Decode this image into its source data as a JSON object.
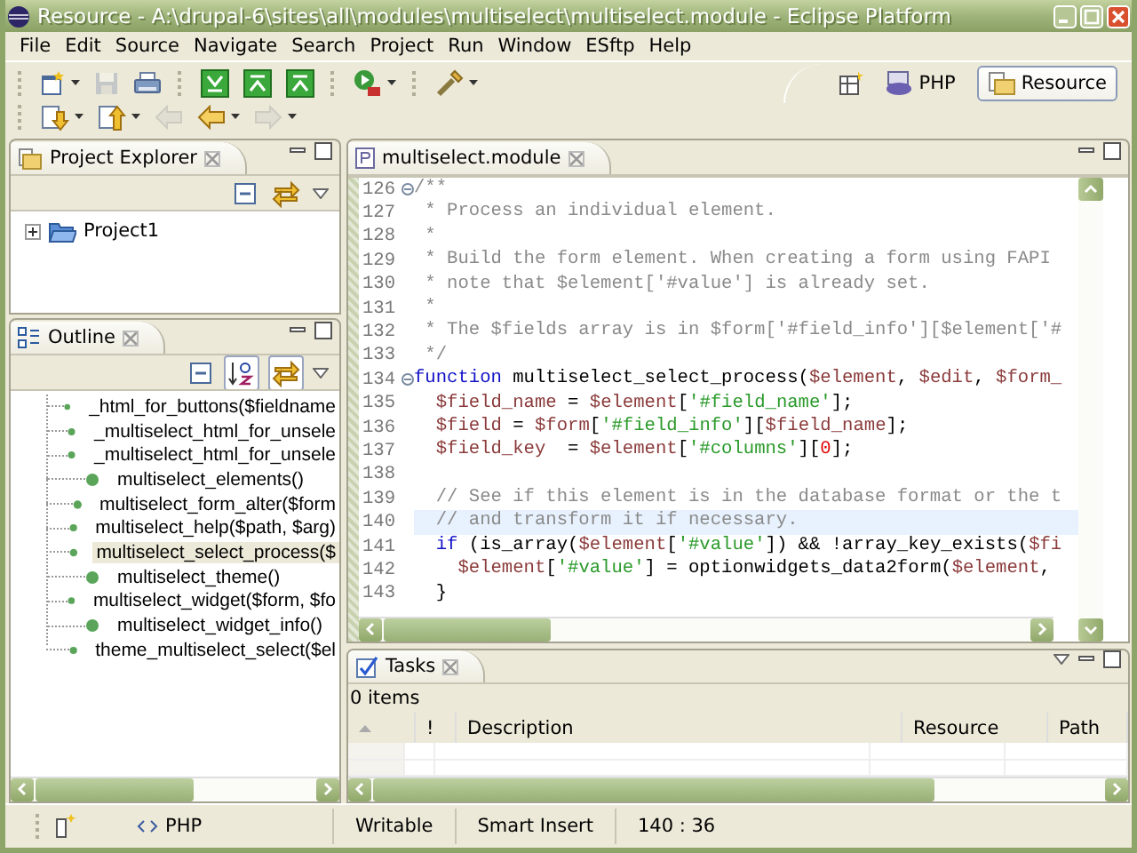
{
  "window": {
    "title": "Resource - A:\\drupal-6\\sites\\all\\modules\\multiselect\\multiselect.module - Eclipse Platform"
  },
  "menu": [
    "File",
    "Edit",
    "Source",
    "Navigate",
    "Search",
    "Project",
    "Run",
    "Window",
    "ESftp",
    "Help"
  ],
  "toolbar": {
    "rows": [
      [
        {
          "kind": "new-wizard",
          "disabled": false,
          "dropdown": true
        },
        {
          "kind": "save",
          "disabled": true,
          "dropdown": false
        },
        {
          "kind": "print",
          "disabled": false,
          "dropdown": false
        },
        {
          "kind": "separator"
        },
        {
          "kind": "green-down",
          "disabled": false,
          "dropdown": false
        },
        {
          "kind": "green-up",
          "disabled": false,
          "dropdown": false
        },
        {
          "kind": "green-up",
          "disabled": false,
          "dropdown": false
        },
        {
          "kind": "separator"
        },
        {
          "kind": "run",
          "disabled": false,
          "dropdown": true
        },
        {
          "kind": "separator"
        },
        {
          "kind": "tool",
          "disabled": false,
          "dropdown": true
        }
      ],
      [
        {
          "kind": "annotation-next",
          "disabled": false,
          "dropdown": true
        },
        {
          "kind": "annotation-prev",
          "disabled": false,
          "dropdown": true
        },
        {
          "kind": "back",
          "disabled": true,
          "dropdown": false
        },
        {
          "kind": "back",
          "disabled": false,
          "dropdown": true
        },
        {
          "kind": "forward",
          "disabled": true,
          "dropdown": true
        }
      ]
    ]
  },
  "perspectives": [
    {
      "label": "PHP",
      "selected": false
    },
    {
      "label": "Resource",
      "selected": true
    }
  ],
  "project_explorer": {
    "title": "Project Explorer",
    "tools": [
      {
        "kind": "collapse",
        "pressed": false
      },
      {
        "kind": "link",
        "pressed": false
      }
    ],
    "tree": [
      {
        "label": "Project1",
        "expanded": false
      }
    ]
  },
  "outline": {
    "title": "Outline",
    "tools": [
      {
        "kind": "collapse",
        "pressed": false
      },
      {
        "kind": "sort",
        "pressed": true
      },
      {
        "kind": "link",
        "pressed": true
      }
    ],
    "items": [
      {
        "label": "_html_for_buttons($fieldname",
        "selected": false
      },
      {
        "label": "_multiselect_html_for_unsele",
        "selected": false
      },
      {
        "label": "_multiselect_html_for_unsele",
        "selected": false
      },
      {
        "label": "multiselect_elements()",
        "selected": false
      },
      {
        "label": "multiselect_form_alter($form",
        "selected": false
      },
      {
        "label": "multiselect_help($path, $arg)",
        "selected": false
      },
      {
        "label": "multiselect_select_process($",
        "selected": true
      },
      {
        "label": "multiselect_theme()",
        "selected": false
      },
      {
        "label": "multiselect_widget($form, $fo",
        "selected": false
      },
      {
        "label": "multiselect_widget_info()",
        "selected": false
      },
      {
        "label": "theme_multiselect_select($el",
        "selected": false
      }
    ]
  },
  "editor": {
    "tab": "multiselect.module",
    "lines": [
      {
        "number": "126",
        "fold": true,
        "current": false,
        "tokens": [
          {
            "kind": "comment",
            "text": "/**"
          }
        ]
      },
      {
        "number": "127",
        "fold": false,
        "current": false,
        "tokens": [
          {
            "kind": "comment",
            "text": " * Process an individual element."
          }
        ]
      },
      {
        "number": "128",
        "fold": false,
        "current": false,
        "tokens": [
          {
            "kind": "comment",
            "text": " *"
          }
        ]
      },
      {
        "number": "129",
        "fold": false,
        "current": false,
        "tokens": [
          {
            "kind": "comment",
            "text": " * Build the form element. When creating a form using FAPI"
          }
        ]
      },
      {
        "number": "130",
        "fold": false,
        "current": false,
        "tokens": [
          {
            "kind": "comment",
            "text": " * note that $element['#value'] is already set."
          }
        ]
      },
      {
        "number": "131",
        "fold": false,
        "current": false,
        "tokens": [
          {
            "kind": "comment",
            "text": " *"
          }
        ]
      },
      {
        "number": "132",
        "fold": false,
        "current": false,
        "tokens": [
          {
            "kind": "comment",
            "text": " * The $fields array is in $form['#field_info'][$element['#"
          }
        ]
      },
      {
        "number": "133",
        "fold": false,
        "current": false,
        "tokens": [
          {
            "kind": "comment",
            "text": " */"
          }
        ]
      },
      {
        "number": "134",
        "fold": true,
        "current": false,
        "tokens": [
          {
            "kind": "keyword",
            "text": "function"
          },
          {
            "kind": "plain",
            "text": " multiselect_select_process("
          },
          {
            "kind": "variable",
            "text": "$element"
          },
          {
            "kind": "plain",
            "text": ", "
          },
          {
            "kind": "variable",
            "text": "$edit"
          },
          {
            "kind": "plain",
            "text": ", "
          },
          {
            "kind": "variable",
            "text": "$form_"
          }
        ]
      },
      {
        "number": "135",
        "fold": false,
        "current": false,
        "tokens": [
          {
            "kind": "variable",
            "text": "  $field_name"
          },
          {
            "kind": "plain",
            "text": " = "
          },
          {
            "kind": "variable",
            "text": "$element"
          },
          {
            "kind": "plain",
            "text": "["
          },
          {
            "kind": "string",
            "text": "'#field_name'"
          },
          {
            "kind": "plain",
            "text": "];"
          }
        ]
      },
      {
        "number": "136",
        "fold": false,
        "current": false,
        "tokens": [
          {
            "kind": "variable",
            "text": "  $field"
          },
          {
            "kind": "plain",
            "text": " = "
          },
          {
            "kind": "variable",
            "text": "$form"
          },
          {
            "kind": "plain",
            "text": "["
          },
          {
            "kind": "string",
            "text": "'#field_info'"
          },
          {
            "kind": "plain",
            "text": "]["
          },
          {
            "kind": "variable",
            "text": "$field_name"
          },
          {
            "kind": "plain",
            "text": "];"
          }
        ]
      },
      {
        "number": "137",
        "fold": false,
        "current": false,
        "tokens": [
          {
            "kind": "variable",
            "text": "  $field_key"
          },
          {
            "kind": "plain",
            "text": "  = "
          },
          {
            "kind": "variable",
            "text": "$element"
          },
          {
            "kind": "plain",
            "text": "["
          },
          {
            "kind": "string",
            "text": "'#columns'"
          },
          {
            "kind": "plain",
            "text": "]["
          },
          {
            "kind": "number",
            "text": "0"
          },
          {
            "kind": "plain",
            "text": "];"
          }
        ]
      },
      {
        "number": "138",
        "fold": false,
        "current": false
      },
      {
        "number": "139",
        "fold": false,
        "current": false,
        "tokens": [
          {
            "kind": "comment",
            "text": "  // See if this element is in the database format or the t"
          }
        ]
      },
      {
        "number": "140",
        "fold": false,
        "current": true,
        "tokens": [
          {
            "kind": "comment",
            "text": "  // and transform it if necessary."
          }
        ]
      },
      {
        "number": "141",
        "fold": false,
        "current": false,
        "tokens": [
          {
            "kind": "keyword",
            "text": "  if"
          },
          {
            "kind": "plain",
            "text": " (is_array("
          },
          {
            "kind": "variable",
            "text": "$element"
          },
          {
            "kind": "plain",
            "text": "["
          },
          {
            "kind": "string",
            "text": "'#value'"
          },
          {
            "kind": "plain",
            "text": "]) && !array_key_exists("
          },
          {
            "kind": "variable",
            "text": "$fi"
          }
        ]
      },
      {
        "number": "142",
        "fold": false,
        "current": false,
        "tokens": [
          {
            "kind": "variable",
            "text": "    $element"
          },
          {
            "kind": "plain",
            "text": "["
          },
          {
            "kind": "string",
            "text": "'#value'"
          },
          {
            "kind": "plain",
            "text": "] = optionwidgets_data2form("
          },
          {
            "kind": "variable",
            "text": "$element"
          },
          {
            "kind": "plain",
            "text": ","
          }
        ]
      },
      {
        "number": "143",
        "fold": false,
        "current": false,
        "tokens": [
          {
            "kind": "plain",
            "text": "  }"
          }
        ]
      }
    ]
  },
  "tasks": {
    "title": "Tasks",
    "count": "0 items",
    "columns": [
      {
        "kind": "sort"
      },
      {
        "kind": "text",
        "label": "!"
      },
      {
        "kind": "text",
        "label": "Description"
      },
      {
        "kind": "text",
        "label": "Resource"
      },
      {
        "kind": "text",
        "label": "Path"
      }
    ]
  },
  "status_bar": {
    "fast_view": "PHP",
    "fields": [
      "Writable",
      "Smart Insert",
      "140 : 36"
    ]
  }
}
